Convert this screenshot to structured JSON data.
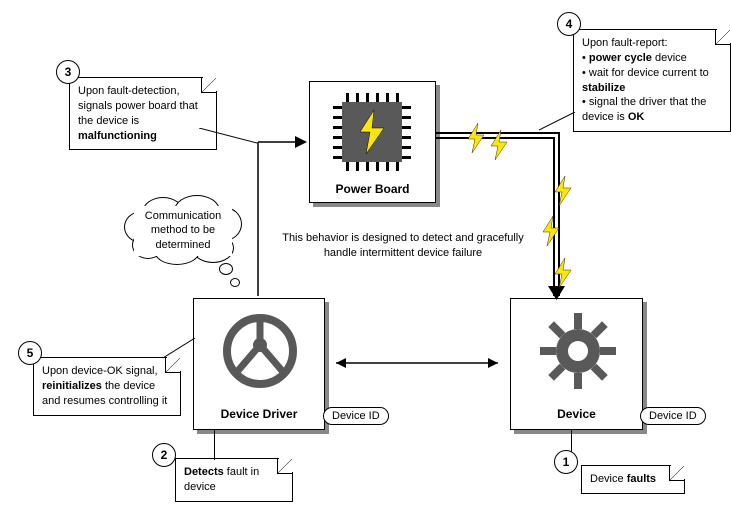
{
  "type": "flow-diagram",
  "entities": {
    "power_board": "Power Board",
    "device_driver": "Device Driver",
    "device": "Device",
    "device_id": "Device ID"
  },
  "cloud": "Communication method to be determined",
  "caption": "This behavior is designed to detect and gracefully handle intermittent device failure",
  "steps": [
    {
      "n": "1",
      "html": "Device <b>faults</b>"
    },
    {
      "n": "2",
      "html": "<b>Detects</b> fault in device"
    },
    {
      "n": "3",
      "html": "Upon fault-detection, signals power board that the device is <b>malfunctioning</b>"
    },
    {
      "n": "4",
      "html": "Upon fault-report:<br>• <b>power cycle</b> device<br>• wait for device current to <b>stabilize</b><br>• signal the driver that the device is <b>OK</b>"
    },
    {
      "n": "5",
      "html": "Upon device-OK signal, <b>reinitializes</b> the device and resumes controlling it"
    }
  ]
}
